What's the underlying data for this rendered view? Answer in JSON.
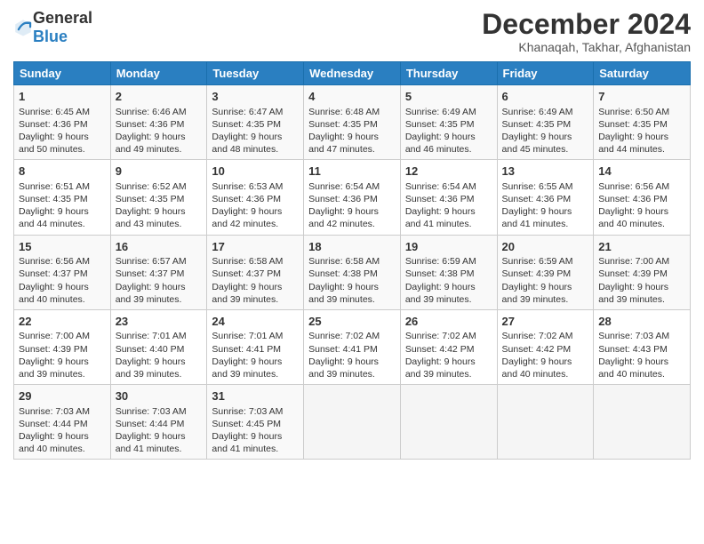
{
  "header": {
    "logo_general": "General",
    "logo_blue": "Blue",
    "month_title": "December 2024",
    "subtitle": "Khanaqah, Takhar, Afghanistan"
  },
  "days_of_week": [
    "Sunday",
    "Monday",
    "Tuesday",
    "Wednesday",
    "Thursday",
    "Friday",
    "Saturday"
  ],
  "weeks": [
    [
      {
        "day": "1",
        "sunrise": "Sunrise: 6:45 AM",
        "sunset": "Sunset: 4:36 PM",
        "daylight": "Daylight: 9 hours and 50 minutes."
      },
      {
        "day": "2",
        "sunrise": "Sunrise: 6:46 AM",
        "sunset": "Sunset: 4:36 PM",
        "daylight": "Daylight: 9 hours and 49 minutes."
      },
      {
        "day": "3",
        "sunrise": "Sunrise: 6:47 AM",
        "sunset": "Sunset: 4:35 PM",
        "daylight": "Daylight: 9 hours and 48 minutes."
      },
      {
        "day": "4",
        "sunrise": "Sunrise: 6:48 AM",
        "sunset": "Sunset: 4:35 PM",
        "daylight": "Daylight: 9 hours and 47 minutes."
      },
      {
        "day": "5",
        "sunrise": "Sunrise: 6:49 AM",
        "sunset": "Sunset: 4:35 PM",
        "daylight": "Daylight: 9 hours and 46 minutes."
      },
      {
        "day": "6",
        "sunrise": "Sunrise: 6:49 AM",
        "sunset": "Sunset: 4:35 PM",
        "daylight": "Daylight: 9 hours and 45 minutes."
      },
      {
        "day": "7",
        "sunrise": "Sunrise: 6:50 AM",
        "sunset": "Sunset: 4:35 PM",
        "daylight": "Daylight: 9 hours and 44 minutes."
      }
    ],
    [
      {
        "day": "8",
        "sunrise": "Sunrise: 6:51 AM",
        "sunset": "Sunset: 4:35 PM",
        "daylight": "Daylight: 9 hours and 44 minutes."
      },
      {
        "day": "9",
        "sunrise": "Sunrise: 6:52 AM",
        "sunset": "Sunset: 4:35 PM",
        "daylight": "Daylight: 9 hours and 43 minutes."
      },
      {
        "day": "10",
        "sunrise": "Sunrise: 6:53 AM",
        "sunset": "Sunset: 4:36 PM",
        "daylight": "Daylight: 9 hours and 42 minutes."
      },
      {
        "day": "11",
        "sunrise": "Sunrise: 6:54 AM",
        "sunset": "Sunset: 4:36 PM",
        "daylight": "Daylight: 9 hours and 42 minutes."
      },
      {
        "day": "12",
        "sunrise": "Sunrise: 6:54 AM",
        "sunset": "Sunset: 4:36 PM",
        "daylight": "Daylight: 9 hours and 41 minutes."
      },
      {
        "day": "13",
        "sunrise": "Sunrise: 6:55 AM",
        "sunset": "Sunset: 4:36 PM",
        "daylight": "Daylight: 9 hours and 41 minutes."
      },
      {
        "day": "14",
        "sunrise": "Sunrise: 6:56 AM",
        "sunset": "Sunset: 4:36 PM",
        "daylight": "Daylight: 9 hours and 40 minutes."
      }
    ],
    [
      {
        "day": "15",
        "sunrise": "Sunrise: 6:56 AM",
        "sunset": "Sunset: 4:37 PM",
        "daylight": "Daylight: 9 hours and 40 minutes."
      },
      {
        "day": "16",
        "sunrise": "Sunrise: 6:57 AM",
        "sunset": "Sunset: 4:37 PM",
        "daylight": "Daylight: 9 hours and 39 minutes."
      },
      {
        "day": "17",
        "sunrise": "Sunrise: 6:58 AM",
        "sunset": "Sunset: 4:37 PM",
        "daylight": "Daylight: 9 hours and 39 minutes."
      },
      {
        "day": "18",
        "sunrise": "Sunrise: 6:58 AM",
        "sunset": "Sunset: 4:38 PM",
        "daylight": "Daylight: 9 hours and 39 minutes."
      },
      {
        "day": "19",
        "sunrise": "Sunrise: 6:59 AM",
        "sunset": "Sunset: 4:38 PM",
        "daylight": "Daylight: 9 hours and 39 minutes."
      },
      {
        "day": "20",
        "sunrise": "Sunrise: 6:59 AM",
        "sunset": "Sunset: 4:39 PM",
        "daylight": "Daylight: 9 hours and 39 minutes."
      },
      {
        "day": "21",
        "sunrise": "Sunrise: 7:00 AM",
        "sunset": "Sunset: 4:39 PM",
        "daylight": "Daylight: 9 hours and 39 minutes."
      }
    ],
    [
      {
        "day": "22",
        "sunrise": "Sunrise: 7:00 AM",
        "sunset": "Sunset: 4:39 PM",
        "daylight": "Daylight: 9 hours and 39 minutes."
      },
      {
        "day": "23",
        "sunrise": "Sunrise: 7:01 AM",
        "sunset": "Sunset: 4:40 PM",
        "daylight": "Daylight: 9 hours and 39 minutes."
      },
      {
        "day": "24",
        "sunrise": "Sunrise: 7:01 AM",
        "sunset": "Sunset: 4:41 PM",
        "daylight": "Daylight: 9 hours and 39 minutes."
      },
      {
        "day": "25",
        "sunrise": "Sunrise: 7:02 AM",
        "sunset": "Sunset: 4:41 PM",
        "daylight": "Daylight: 9 hours and 39 minutes."
      },
      {
        "day": "26",
        "sunrise": "Sunrise: 7:02 AM",
        "sunset": "Sunset: 4:42 PM",
        "daylight": "Daylight: 9 hours and 39 minutes."
      },
      {
        "day": "27",
        "sunrise": "Sunrise: 7:02 AM",
        "sunset": "Sunset: 4:42 PM",
        "daylight": "Daylight: 9 hours and 40 minutes."
      },
      {
        "day": "28",
        "sunrise": "Sunrise: 7:03 AM",
        "sunset": "Sunset: 4:43 PM",
        "daylight": "Daylight: 9 hours and 40 minutes."
      }
    ],
    [
      {
        "day": "29",
        "sunrise": "Sunrise: 7:03 AM",
        "sunset": "Sunset: 4:44 PM",
        "daylight": "Daylight: 9 hours and 40 minutes."
      },
      {
        "day": "30",
        "sunrise": "Sunrise: 7:03 AM",
        "sunset": "Sunset: 4:44 PM",
        "daylight": "Daylight: 9 hours and 41 minutes."
      },
      {
        "day": "31",
        "sunrise": "Sunrise: 7:03 AM",
        "sunset": "Sunset: 4:45 PM",
        "daylight": "Daylight: 9 hours and 41 minutes."
      },
      null,
      null,
      null,
      null
    ]
  ]
}
